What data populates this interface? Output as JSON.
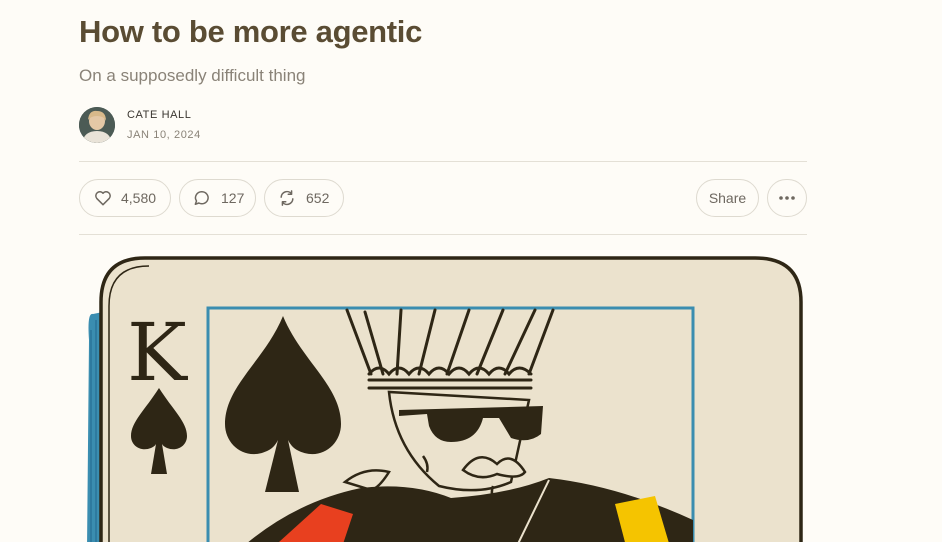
{
  "post": {
    "title": "How to be more agentic",
    "subtitle": "On a supposedly difficult thing"
  },
  "author": {
    "name": "CATE HALL",
    "date": "JAN 10, 2024"
  },
  "actions": {
    "likes": "4,580",
    "comments": "127",
    "restacks": "652",
    "share_label": "Share",
    "more_icon": "ellipsis-icon"
  },
  "illustration": {
    "rank": "K",
    "suit": "spade"
  },
  "colors": {
    "title": "#5a4c33",
    "background": "#fefcf7",
    "card_face": "#ebe2cd",
    "card_ink": "#2e2615",
    "card_border_blue": "#3a8db0",
    "sash_red": "#e8401f",
    "sash_yellow": "#f5c400"
  }
}
